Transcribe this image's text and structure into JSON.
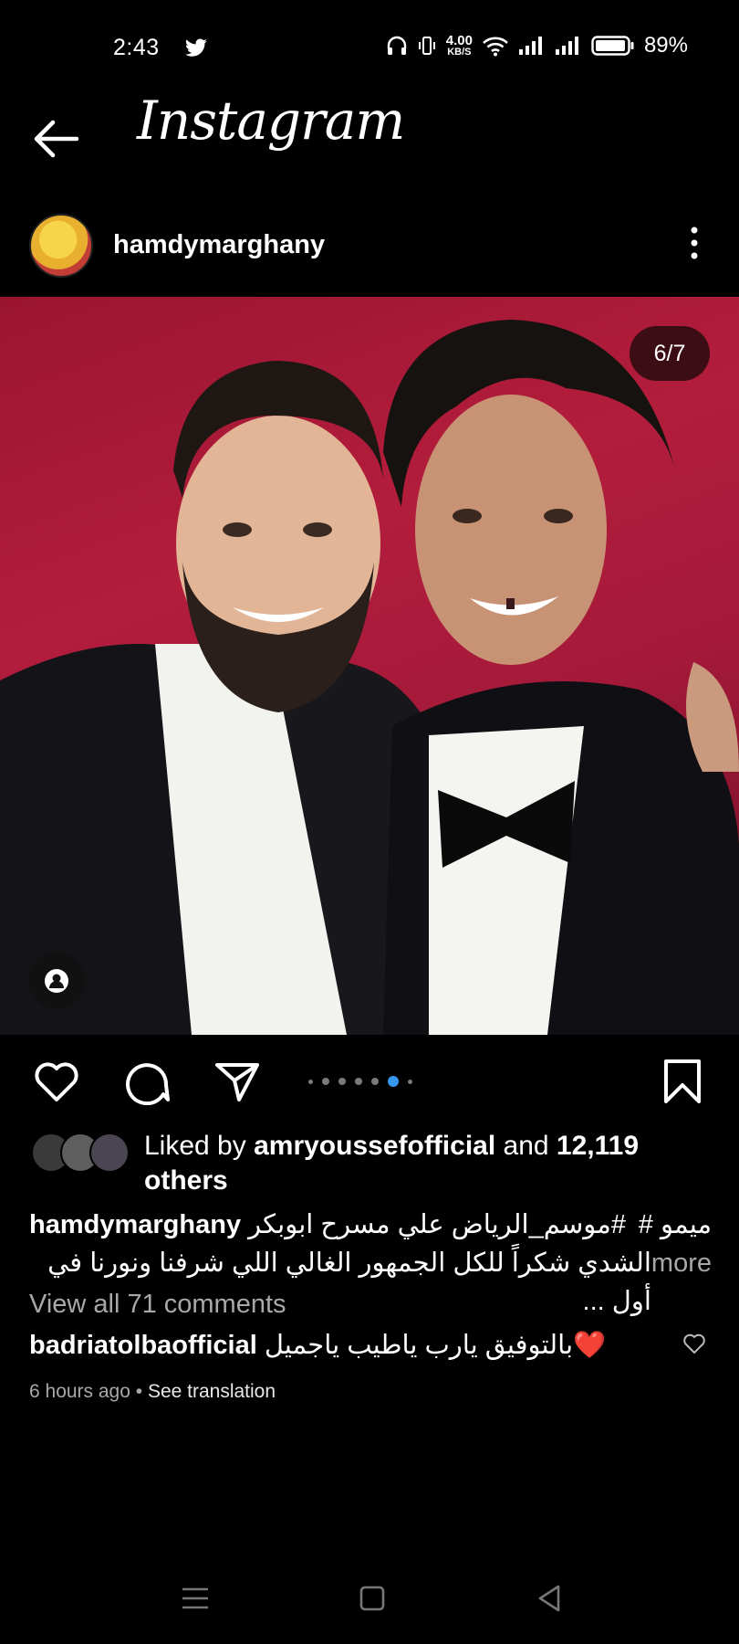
{
  "status": {
    "time": "2:43",
    "net_speed_value": "4.00",
    "net_speed_unit": "KB/S",
    "battery": "89%"
  },
  "header": {
    "brand": "Instagram"
  },
  "post": {
    "username": "hamdymarghany",
    "slide_counter": "6/7",
    "slide_total": 7,
    "slide_active": 6
  },
  "likes": {
    "prefix": "Liked by ",
    "user": "amryoussefofficial",
    "middle": " and ",
    "count": "12,119",
    "line2": "others"
  },
  "caption": {
    "username": "hamdymarghany",
    "line1_text": "#موسم_الرياض  علي مسرح ابوبكر",
    "line1_end": "ميمو  #",
    "line2_text": "الشدي شكراً للكل الجمهور الغالي اللي شرفنا ونورنا في أول ...",
    "more": "more"
  },
  "comments": {
    "view_all": "View all 71 comments",
    "first_user": "badriatolbaofficial",
    "first_text": "بالتوفيق يارب ياطيب ياجميل",
    "first_emoji": "❤️"
  },
  "meta": {
    "time_ago": "6 hours ago",
    "sep": " • ",
    "see_translation": "See translation"
  },
  "colors": {
    "background": "#000000",
    "accent": "#3897f0",
    "muted": "#a8a8a8",
    "photo_backdrop": "#a61a38"
  },
  "icons": [
    "twitter-icon",
    "headphones-icon",
    "vibrate-icon",
    "wifi-icon",
    "signal-icon",
    "battery-icon",
    "back-arrow-icon",
    "more-vertical-icon",
    "tag-person-icon",
    "heart-icon",
    "comment-icon",
    "share-icon",
    "bookmark-icon",
    "menu-icon",
    "home-square-icon",
    "back-triangle-icon"
  ]
}
